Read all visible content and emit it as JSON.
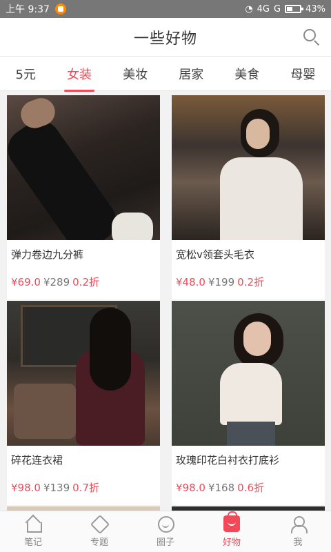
{
  "status_bar": {
    "time": "上午 9:37",
    "network": "4G",
    "carrier_g": "G",
    "battery": "43%"
  },
  "header": {
    "title": "一些好物"
  },
  "tabs": [
    {
      "label": "5元"
    },
    {
      "label": "女装",
      "active": true
    },
    {
      "label": "美妆"
    },
    {
      "label": "居家"
    },
    {
      "label": "美食"
    },
    {
      "label": "母婴"
    }
  ],
  "products": [
    {
      "name": "弹力卷边九分裤",
      "price": "¥69.0",
      "original": "¥289",
      "discount": "0.2折"
    },
    {
      "name": "宽松v领套头毛衣",
      "price": "¥48.0",
      "original": "¥199",
      "discount": "0.2折"
    },
    {
      "name": "碎花连衣裙",
      "price": "¥98.0",
      "original": "¥139",
      "discount": "0.7折"
    },
    {
      "name": "玫瑰印花白衬衣打底衫",
      "price": "¥98.0",
      "original": "¥168",
      "discount": "0.6折"
    }
  ],
  "bottom_nav": [
    {
      "label": "笔记",
      "icon": "home-icon"
    },
    {
      "label": "专题",
      "icon": "tag-icon"
    },
    {
      "label": "圈子",
      "icon": "face-icon"
    },
    {
      "label": "好物",
      "icon": "bag-icon",
      "active": true
    },
    {
      "label": "我",
      "icon": "user-icon"
    }
  ],
  "colors": {
    "accent": "#f04a59",
    "status_bar": "#777777"
  }
}
